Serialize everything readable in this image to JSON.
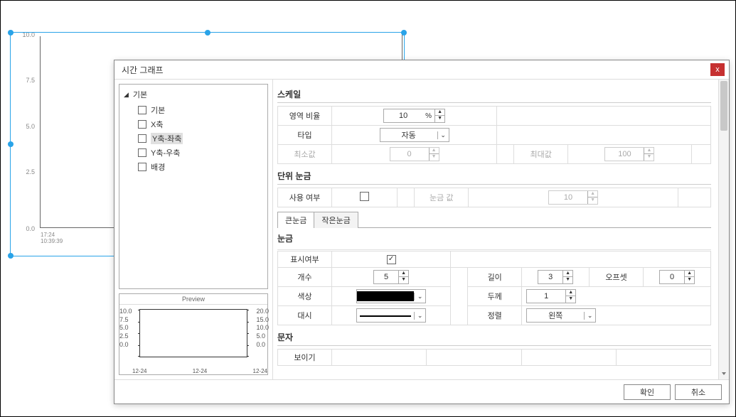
{
  "dialog": {
    "title": "시간 그래프",
    "tree": {
      "root": "기본",
      "items": [
        "기본",
        "X축",
        "Y축-좌축",
        "Y축-우축",
        "배경"
      ],
      "selected_index": 2
    },
    "preview": {
      "title": "Preview",
      "left_ticks": [
        "10.0",
        "7.5",
        "5.0",
        "2.5",
        "0.0"
      ],
      "right_ticks": [
        "20.0",
        "15.0",
        "10.0",
        "5.0",
        "0.0"
      ],
      "x_ticks": [
        "12-24",
        "12-24",
        "12-24"
      ]
    }
  },
  "scale": {
    "title": "스케일",
    "area_ratio_label": "영역 비율",
    "area_ratio_value": "10",
    "area_ratio_unit": "%",
    "type_label": "타입",
    "type_value": "자동",
    "min_label": "최소값",
    "min_value": "0",
    "max_label": "최대값",
    "max_value": "100"
  },
  "unit_tick": {
    "title": "단위 눈금",
    "use_label": "사용 여부",
    "use_checked": false,
    "value_label": "눈금 값",
    "value": "10"
  },
  "tick_tabs": {
    "major": "큰눈금",
    "minor": "작은눈금"
  },
  "tick": {
    "title": "눈금",
    "show_label": "표시여부",
    "show_checked": true,
    "count_label": "개수",
    "count_value": "5",
    "length_label": "길이",
    "length_value": "3",
    "offset_label": "오프셋",
    "offset_value": "0",
    "color_label": "색상",
    "thickness_label": "두께",
    "thickness_value": "1",
    "dash_label": "대시",
    "align_label": "정렬",
    "align_value": "왼쪽"
  },
  "text_section": {
    "title": "문자",
    "show_label": "보이기"
  },
  "footer": {
    "ok": "확인",
    "cancel": "취소"
  },
  "bg_chart": {
    "yticks": [
      "10.0",
      "7.5",
      "5.0",
      "2.5",
      "0.0"
    ],
    "xfooter": [
      "17:24",
      "10:39:39"
    ]
  }
}
